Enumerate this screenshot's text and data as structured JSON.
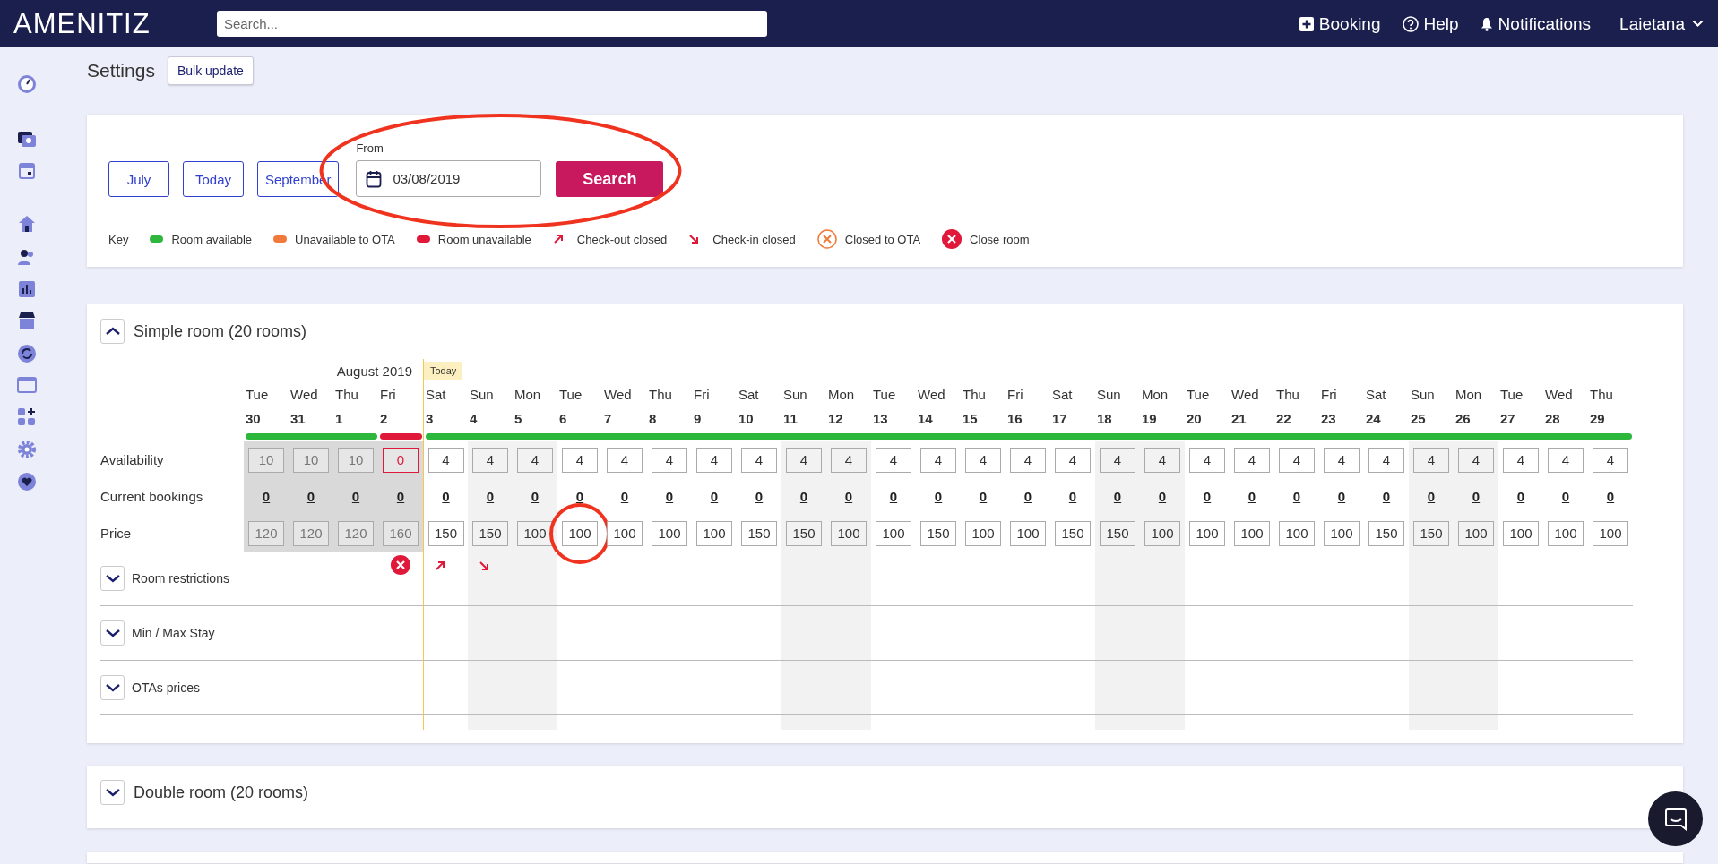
{
  "topbar": {
    "logo": "AMENITIZ",
    "search": {
      "placeholder": "Search..."
    },
    "actions": [
      {
        "kind": "booking",
        "label": "Booking"
      },
      {
        "kind": "help",
        "label": "Help"
      },
      {
        "kind": "notifications",
        "label": "Notifications"
      }
    ],
    "user": "Laietana"
  },
  "page": {
    "title": "Settings",
    "bulk_button": "Bulk update"
  },
  "filters": {
    "month_buttons": [
      "July",
      "Today",
      "September"
    ],
    "from_label": "From",
    "date_value": "03/08/2019",
    "search_button": "Search",
    "circled": true,
    "key_title": "Key",
    "key": [
      {
        "kind": "pill",
        "color": "#2db83d",
        "label": "Room available"
      },
      {
        "kind": "pill",
        "color": "#f07a3c",
        "label": "Unavailable to OTA"
      },
      {
        "kind": "pill",
        "color": "#e0193a",
        "label": "Room unavailable"
      },
      {
        "kind": "checkout_closed",
        "label": "Check-out closed"
      },
      {
        "kind": "checkin_closed",
        "label": "Check-in closed"
      },
      {
        "kind": "closed_to_ota",
        "label": "Closed to OTA"
      },
      {
        "kind": "close_room",
        "label": "Close room"
      }
    ]
  },
  "rooms": [
    {
      "title": "Simple room (20 rooms)",
      "expanded": true,
      "month": "August 2019",
      "today_badge": "Today",
      "row_labels": {
        "availability": "Availability",
        "bookings": "Current bookings",
        "price": "Price"
      },
      "sections": [
        {
          "kind": "restrictions",
          "label": "Room restrictions",
          "expanded": false
        },
        {
          "kind": "stay",
          "label": "Min / Max Stay",
          "expanded": false
        },
        {
          "kind": "ota",
          "label": "OTAs prices",
          "expanded": false
        }
      ],
      "days": [
        {
          "kind": "past",
          "dow": "Tue",
          "date": "30",
          "color": "#2db83d",
          "availability": "10",
          "closed": false,
          "bookings": "0",
          "price": "120",
          "today": false,
          "circled": false
        },
        {
          "kind": "past",
          "dow": "Wed",
          "date": "31",
          "color": "#2db83d",
          "availability": "10",
          "closed": false,
          "bookings": "0",
          "price": "120",
          "today": false,
          "circled": false
        },
        {
          "kind": "past",
          "dow": "Thu",
          "date": "1",
          "color": "#2db83d",
          "availability": "10",
          "closed": false,
          "bookings": "0",
          "price": "120",
          "today": false,
          "circled": false
        },
        {
          "kind": "past",
          "dow": "Fri",
          "date": "2",
          "color": "#e0193a",
          "availability": "0",
          "closed": true,
          "bookings": "0",
          "price": "160",
          "today": false,
          "circled": false,
          "restriction": {
            "kind": "close_room"
          }
        },
        {
          "kind": "plain",
          "dow": "Sat",
          "date": "3",
          "color": "#2db83d",
          "availability": "4",
          "closed": false,
          "bookings": "0",
          "price": "150",
          "today": true,
          "circled": false,
          "restriction": {
            "kind": "checkout_closed"
          }
        },
        {
          "kind": "weekend",
          "dow": "Sun",
          "date": "4",
          "color": "#2db83d",
          "availability": "4",
          "closed": false,
          "bookings": "0",
          "price": "150",
          "today": false,
          "circled": false,
          "restriction": {
            "kind": "checkin_closed"
          }
        },
        {
          "kind": "weekend",
          "dow": "Mon",
          "date": "5",
          "color": "#2db83d",
          "availability": "4",
          "closed": false,
          "bookings": "0",
          "price": "100",
          "today": false,
          "circled": false
        },
        {
          "kind": "plain",
          "dow": "Tue",
          "date": "6",
          "color": "#2db83d",
          "availability": "4",
          "closed": false,
          "bookings": "0",
          "price": "100",
          "today": false,
          "circled": true
        },
        {
          "kind": "plain",
          "dow": "Wed",
          "date": "7",
          "color": "#2db83d",
          "availability": "4",
          "closed": false,
          "bookings": "0",
          "price": "100",
          "today": false,
          "circled": false
        },
        {
          "kind": "plain",
          "dow": "Thu",
          "date": "8",
          "color": "#2db83d",
          "availability": "4",
          "closed": false,
          "bookings": "0",
          "price": "100",
          "today": false,
          "circled": false
        },
        {
          "kind": "plain",
          "dow": "Fri",
          "date": "9",
          "color": "#2db83d",
          "availability": "4",
          "closed": false,
          "bookings": "0",
          "price": "100",
          "today": false,
          "circled": false
        },
        {
          "kind": "plain",
          "dow": "Sat",
          "date": "10",
          "color": "#2db83d",
          "availability": "4",
          "closed": false,
          "bookings": "0",
          "price": "150",
          "today": false,
          "circled": false
        },
        {
          "kind": "weekend",
          "dow": "Sun",
          "date": "11",
          "color": "#2db83d",
          "availability": "4",
          "closed": false,
          "bookings": "0",
          "price": "150",
          "today": false,
          "circled": false
        },
        {
          "kind": "weekend",
          "dow": "Mon",
          "date": "12",
          "color": "#2db83d",
          "availability": "4",
          "closed": false,
          "bookings": "0",
          "price": "100",
          "today": false,
          "circled": false
        },
        {
          "kind": "plain",
          "dow": "Tue",
          "date": "13",
          "color": "#2db83d",
          "availability": "4",
          "closed": false,
          "bookings": "0",
          "price": "100",
          "today": false,
          "circled": false
        },
        {
          "kind": "plain",
          "dow": "Wed",
          "date": "14",
          "color": "#2db83d",
          "availability": "4",
          "closed": false,
          "bookings": "0",
          "price": "150",
          "today": false,
          "circled": false
        },
        {
          "kind": "plain",
          "dow": "Thu",
          "date": "15",
          "color": "#2db83d",
          "availability": "4",
          "closed": false,
          "bookings": "0",
          "price": "100",
          "today": false,
          "circled": false
        },
        {
          "kind": "plain",
          "dow": "Fri",
          "date": "16",
          "color": "#2db83d",
          "availability": "4",
          "closed": false,
          "bookings": "0",
          "price": "100",
          "today": false,
          "circled": false
        },
        {
          "kind": "plain",
          "dow": "Sat",
          "date": "17",
          "color": "#2db83d",
          "availability": "4",
          "closed": false,
          "bookings": "0",
          "price": "150",
          "today": false,
          "circled": false
        },
        {
          "kind": "weekend",
          "dow": "Sun",
          "date": "18",
          "color": "#2db83d",
          "availability": "4",
          "closed": false,
          "bookings": "0",
          "price": "150",
          "today": false,
          "circled": false
        },
        {
          "kind": "weekend",
          "dow": "Mon",
          "date": "19",
          "color": "#2db83d",
          "availability": "4",
          "closed": false,
          "bookings": "0",
          "price": "100",
          "today": false,
          "circled": false
        },
        {
          "kind": "plain",
          "dow": "Tue",
          "date": "20",
          "color": "#2db83d",
          "availability": "4",
          "closed": false,
          "bookings": "0",
          "price": "100",
          "today": false,
          "circled": false
        },
        {
          "kind": "plain",
          "dow": "Wed",
          "date": "21",
          "color": "#2db83d",
          "availability": "4",
          "closed": false,
          "bookings": "0",
          "price": "100",
          "today": false,
          "circled": false
        },
        {
          "kind": "plain",
          "dow": "Thu",
          "date": "22",
          "color": "#2db83d",
          "availability": "4",
          "closed": false,
          "bookings": "0",
          "price": "100",
          "today": false,
          "circled": false
        },
        {
          "kind": "plain",
          "dow": "Fri",
          "date": "23",
          "color": "#2db83d",
          "availability": "4",
          "closed": false,
          "bookings": "0",
          "price": "100",
          "today": false,
          "circled": false
        },
        {
          "kind": "plain",
          "dow": "Sat",
          "date": "24",
          "color": "#2db83d",
          "availability": "4",
          "closed": false,
          "bookings": "0",
          "price": "150",
          "today": false,
          "circled": false
        },
        {
          "kind": "weekend",
          "dow": "Sun",
          "date": "25",
          "color": "#2db83d",
          "availability": "4",
          "closed": false,
          "bookings": "0",
          "price": "150",
          "today": false,
          "circled": false
        },
        {
          "kind": "weekend",
          "dow": "Mon",
          "date": "26",
          "color": "#2db83d",
          "availability": "4",
          "closed": false,
          "bookings": "0",
          "price": "100",
          "today": false,
          "circled": false
        },
        {
          "kind": "plain",
          "dow": "Tue",
          "date": "27",
          "color": "#2db83d",
          "availability": "4",
          "closed": false,
          "bookings": "0",
          "price": "100",
          "today": false,
          "circled": false
        },
        {
          "kind": "plain",
          "dow": "Wed",
          "date": "28",
          "color": "#2db83d",
          "availability": "4",
          "closed": false,
          "bookings": "0",
          "price": "100",
          "today": false,
          "circled": false
        },
        {
          "kind": "plain",
          "dow": "Thu",
          "date": "29",
          "color": "#2db83d",
          "availability": "4",
          "closed": false,
          "bookings": "0",
          "price": "100",
          "today": false,
          "circled": false
        }
      ]
    },
    {
      "title": "Double room (20 rooms)",
      "expanded": false
    }
  ]
}
